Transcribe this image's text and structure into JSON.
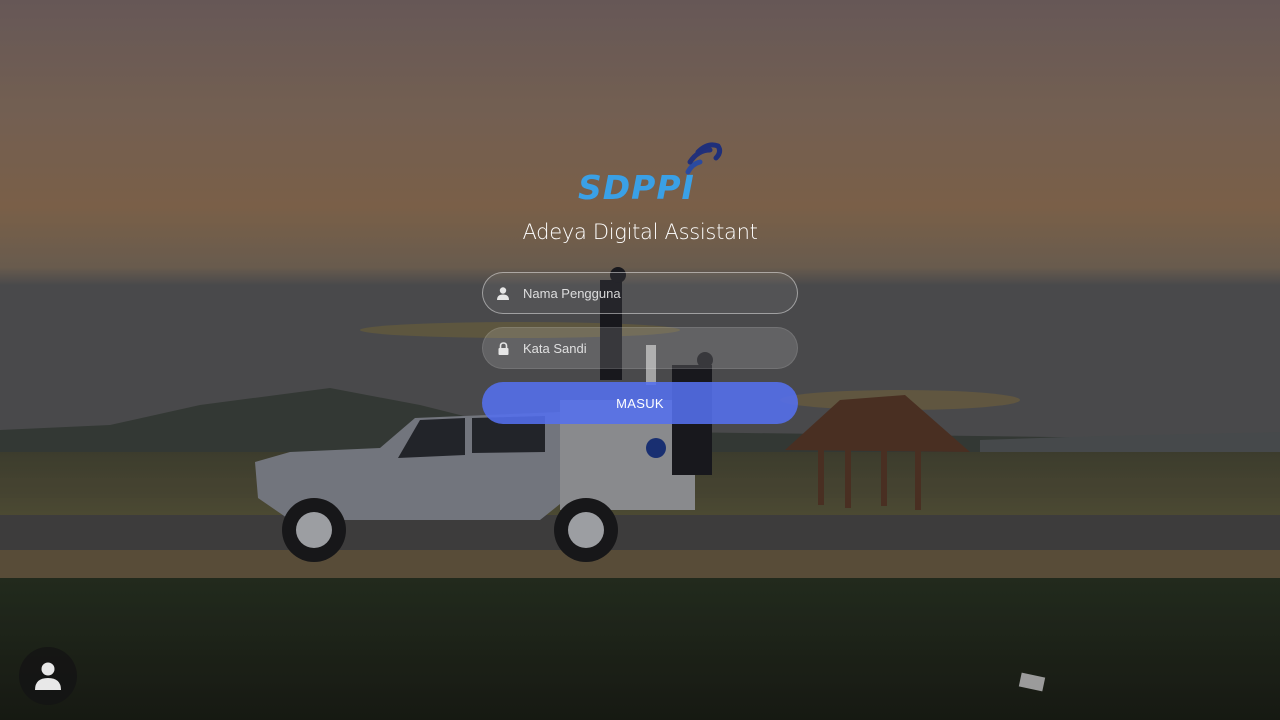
{
  "app": {
    "logo_text": "SDPPI",
    "title": "Adeya Digital Assistant"
  },
  "login": {
    "username_placeholder": "Nama Pengguna",
    "password_placeholder": "Kata Sandi",
    "submit_label": "MASUK"
  },
  "icons": {
    "username": "user-icon",
    "password": "lock-icon",
    "avatar": "person-icon"
  },
  "colors": {
    "logo_blue": "#3aa0e6",
    "logo_navy": "#1f2f7a",
    "button": "#5470ee"
  }
}
